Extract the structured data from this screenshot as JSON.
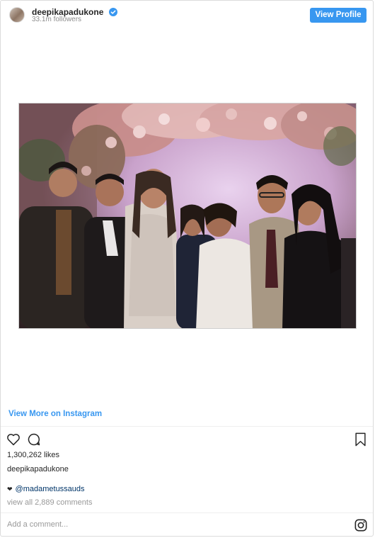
{
  "header": {
    "username": "deepikapadukone",
    "followers": "33.1m followers",
    "view_profile_label": "View Profile"
  },
  "photo": {
    "alt": "Group photo at a reception with a floral arch"
  },
  "view_more_label": "View More on Instagram",
  "actions": {
    "likes": "1,300,262 likes",
    "caption_user": "deepikapadukone",
    "mention": "@madametussauds",
    "view_comments": "view all 2,889 comments"
  },
  "comment_box": {
    "placeholder": "Add a comment..."
  },
  "colors": {
    "accent": "#3897f0",
    "mention": "#003569",
    "muted": "#8e8e8e"
  },
  "icons": [
    "heart-icon",
    "comment-icon",
    "bookmark-icon",
    "instagram-logo-icon",
    "verified-badge-icon"
  ]
}
